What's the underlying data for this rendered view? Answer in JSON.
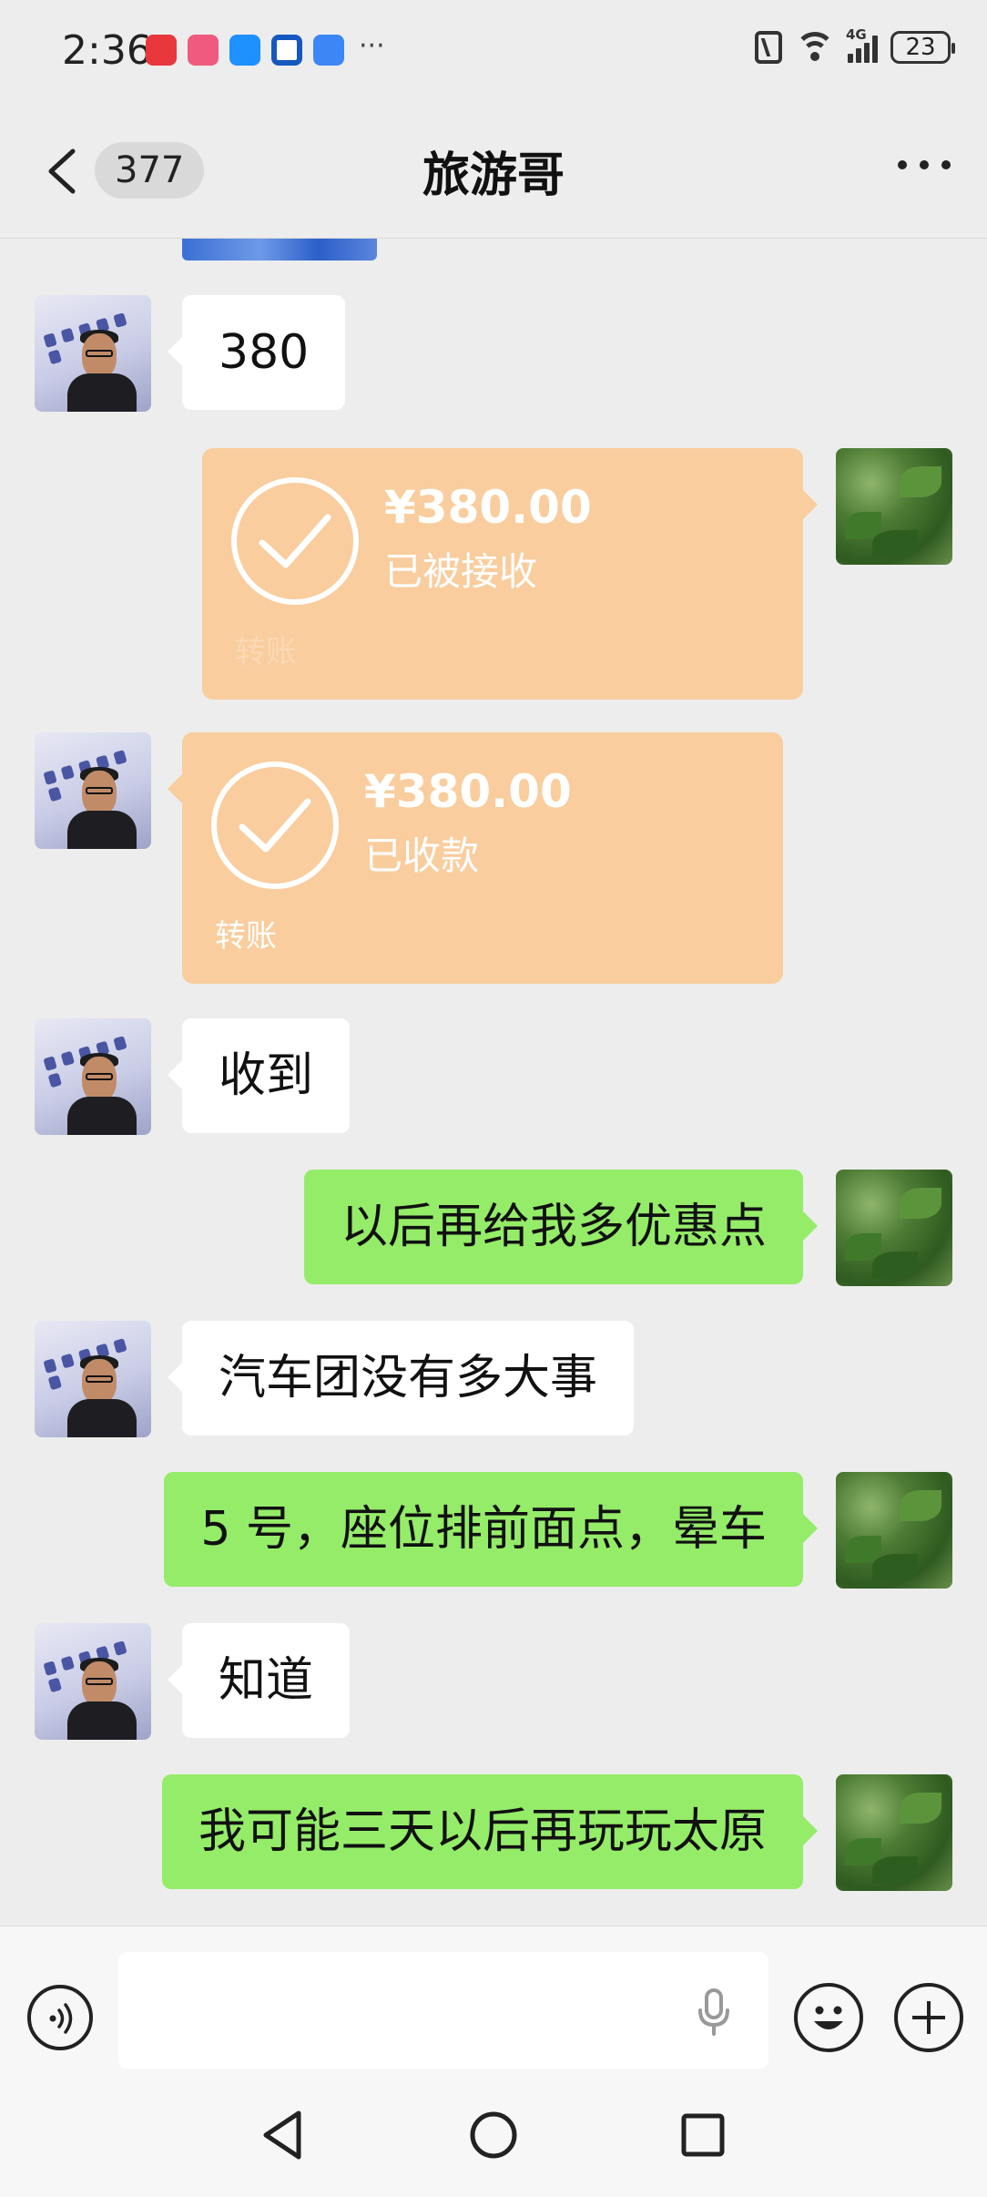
{
  "status_bar": {
    "time": "2:36",
    "network": "4G",
    "battery": "23",
    "more": "···",
    "notification_icons": [
      {
        "name": "huawei-appgallery-icon",
        "color": "#e8373d"
      },
      {
        "name": "game-app-icon",
        "color": "#f05a7e"
      },
      {
        "name": "message-app-icon",
        "color": "#1e90ff"
      },
      {
        "name": "c-app-icon",
        "color": "#1558c0"
      },
      {
        "name": "upload-app-icon",
        "color": "#3d86f5"
      }
    ]
  },
  "header": {
    "unread_count": "377",
    "title": "旅游哥"
  },
  "messages": [
    {
      "side": "left",
      "type": "text",
      "text": "380"
    },
    {
      "side": "right",
      "type": "transfer",
      "amount": "¥380.00",
      "status": "已被接收",
      "label": "转账"
    },
    {
      "side": "left",
      "type": "transfer",
      "amount": "¥380.00",
      "status": "已收款",
      "label": "转账"
    },
    {
      "side": "left",
      "type": "text",
      "text": "收到"
    },
    {
      "side": "right",
      "type": "text",
      "text": "以后再给我多优惠点"
    },
    {
      "side": "left",
      "type": "text",
      "text": "汽车团没有多大事"
    },
    {
      "side": "right",
      "type": "text",
      "text": "5 号，座位排前面点，晕车"
    },
    {
      "side": "left",
      "type": "text",
      "text": "知道"
    },
    {
      "side": "right",
      "type": "text",
      "text": "我可能三天以后再玩玩太原"
    }
  ],
  "input": {
    "placeholder": ""
  },
  "colors": {
    "background": "#ededed",
    "my_bubble": "#95ec69",
    "other_bubble": "#ffffff",
    "transfer_bubble": "#f9cd9e"
  }
}
